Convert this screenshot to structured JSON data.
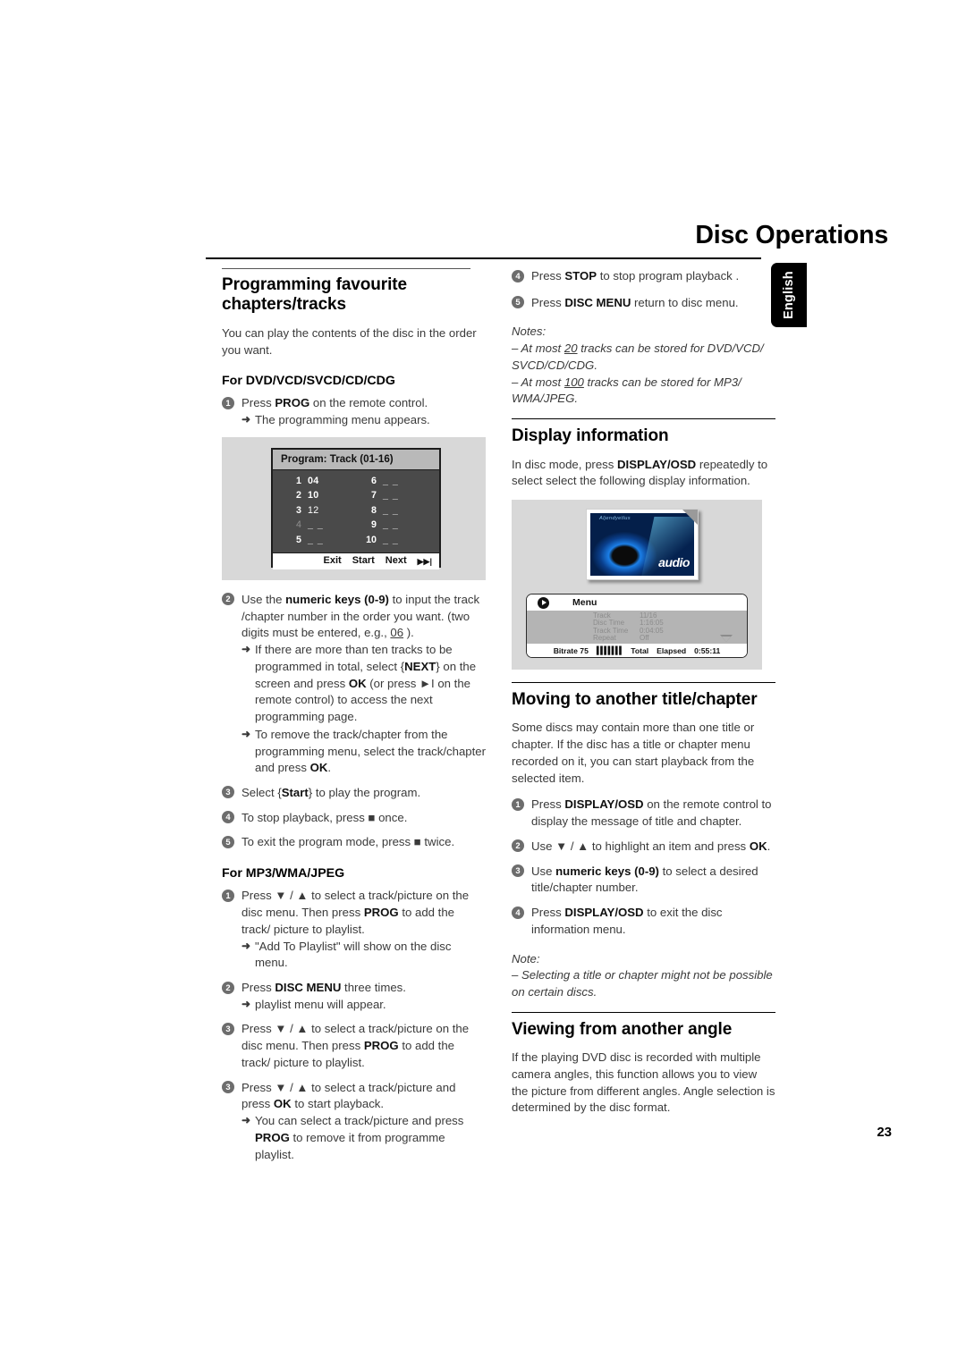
{
  "header": {
    "chapter_title": "Disc Operations",
    "language_tab": "English"
  },
  "page_number": "23",
  "left_column": {
    "section_title": "Programming favourite chapters/tracks",
    "intro": "You can play the contents of the disc in the order you want.",
    "subhead_dvd": "For DVD/VCD/SVCD/CD/CDG",
    "step1": {
      "num": "1",
      "text_pre": "Press ",
      "bold": "PROG",
      "text_post": " on the remote control."
    },
    "step1_arrow": "The programming menu appears.",
    "program_menu": {
      "title": "Program: Track (01-16)",
      "entries_left": [
        {
          "index": "1",
          "value": "04",
          "filled": true,
          "dim": false
        },
        {
          "index": "2",
          "value": "10",
          "filled": true,
          "dim": false
        },
        {
          "index": "3",
          "value": "12",
          "filled": true,
          "dim": false
        },
        {
          "index": "4",
          "value": "_ _",
          "filled": false,
          "dim": true
        },
        {
          "index": "5",
          "value": "_ _",
          "filled": false,
          "dim": false
        }
      ],
      "entries_right": [
        {
          "index": "6",
          "value": "_ _",
          "filled": false,
          "dim": false
        },
        {
          "index": "7",
          "value": "_ _",
          "filled": false,
          "dim": false
        },
        {
          "index": "8",
          "value": "_ _",
          "filled": false,
          "dim": false
        },
        {
          "index": "9",
          "value": "_ _",
          "filled": false,
          "dim": false
        },
        {
          "index": "10",
          "value": "_ _",
          "filled": false,
          "dim": false
        }
      ],
      "buttons": [
        "Exit",
        "Start",
        "Next"
      ],
      "next_icon": "skip-forward-icon"
    },
    "step2": {
      "num": "2",
      "p1_a": "Use the ",
      "p1_b": "numeric keys (0-9)",
      "p1_c": " to input the track /chapter number in the order you want. (two digits must be entered, e.g., ",
      "p1_u": "06",
      "p1_d": " )."
    },
    "step2_arrow1_a": "If there are more than ten tracks to be programmed in total, select {",
    "step2_arrow1_b": "NEXT",
    "step2_arrow1_c": "} on the screen and press ",
    "step2_arrow1_d": "OK",
    "step2_arrow1_e": " (or press ►I on the remote control) to access the next programming page.",
    "step2_arrow2_a": "To remove the track/chapter from the programming menu, select the track/chapter and press ",
    "step2_arrow2_b": "OK",
    "step2_arrow2_c": ".",
    "step3": {
      "num": "3",
      "a": "Select {",
      "b": "Start",
      "c": "} to play the program."
    },
    "step4": {
      "num": "4",
      "a": "To stop playback, press ■ once."
    },
    "step5": {
      "num": "5",
      "a": "To exit the program mode, press ■ twice."
    },
    "subhead_mp3": "For MP3/WMA/JPEG",
    "mp3_step1": {
      "num": "1",
      "a": "Press ▼ / ▲ to select a track/picture on the disc menu. Then press ",
      "b": "PROG",
      "c": " to add the track/ picture to playlist."
    },
    "mp3_step1_arrow": "\"Add To Playlist\" will show on the disc menu.",
    "mp3_step2": {
      "num": "2",
      "a": "Press ",
      "b": "DISC MENU",
      "c": " three times."
    },
    "mp3_step2_arrow": "playlist menu will appear.",
    "mp3_step3": {
      "num": "3",
      "a": "Press ▼ / ▲ to select a track/picture on the disc menu. Then press ",
      "b": "PROG",
      "c": " to add the track/ picture to playlist."
    },
    "mp3_step4": {
      "num": "3",
      "a": "Press ▼ / ▲ to select a track/picture and press ",
      "b": "OK",
      "c": " to start playback."
    },
    "mp3_step4_arrow_a": "You can select a track/picture and press ",
    "mp3_step4_arrow_b": "PROG",
    "mp3_step4_arrow_c": " to remove it from programme playlist."
  },
  "right_column": {
    "step4": {
      "num": "4",
      "a": "Press ",
      "b": "STOP",
      "c": " to stop program playback ."
    },
    "step5": {
      "num": "5",
      "a": "Press ",
      "b": "DISC MENU",
      "c": " return to disc menu."
    },
    "notes_heading": "Notes:",
    "note1_a": "–  At most ",
    "note1_u": "20",
    "note1_b": "  tracks can be stored for DVD/VCD/ SVCD/CD/CDG.",
    "note2_a": "–  At most ",
    "note2_u": "100",
    "note2_b": " tracks can be stored for MP3/ WMA/JPEG.",
    "display_info": {
      "title": "Display information",
      "body_a": "In disc mode, press ",
      "body_b": "DISPLAY/OSD",
      "body_c": " repeatedly to select select the following display information.",
      "osd": {
        "cover_wordmark": "Aljendyetlus",
        "cover_label": "audio",
        "menu_label": "Menu",
        "rows": [
          {
            "key": "Track",
            "value": "11/16"
          },
          {
            "key": "Disc Time",
            "value": "1:16:05"
          },
          {
            "key": "Track Time",
            "value": "0:04:05"
          },
          {
            "key": "Repeat",
            "value": "Off"
          }
        ],
        "footer": {
          "bitrate_label": "Bitrate 75",
          "bars": "▌▌▌▌▌▌▌",
          "total": "Total",
          "elapsed": "Elapsed",
          "time": "0:55:11"
        }
      }
    },
    "moving": {
      "title": "Moving to another title/chapter",
      "body": "Some discs may contain more than one title or chapter. If the disc has a title or chapter menu recorded on it, you can start playback from the selected item.",
      "step1": {
        "num": "1",
        "a": "Press ",
        "b": "DISPLAY/OSD",
        "c": " on the remote control to display the message of title and chapter."
      },
      "step2": {
        "num": "2",
        "a": "Use ▼ / ▲ to highlight an item and press ",
        "b": "OK",
        "c": "."
      },
      "step3": {
        "num": "3",
        "a": "Use ",
        "b": "numeric keys (0-9)",
        "c": " to select a desired title/chapter number."
      },
      "step4": {
        "num": "4",
        "a": "Press ",
        "b": "DISPLAY/OSD",
        "c": " to exit the disc information menu."
      },
      "note_heading": "Note:",
      "note_text": "–  Selecting a title or chapter might not be possible on certain discs."
    },
    "angle": {
      "title": "Viewing from another angle",
      "body": "If the playing DVD disc is recorded with multiple camera angles, this function allows you to view the picture from different angles. Angle selection is determined by the disc format."
    }
  },
  "colors": {
    "figure_bg": "#d8d8d8",
    "osd_dark": "#4a4a4a",
    "osd_title_bar": "#b9b9b9",
    "osd_body_gray": "#b4b4b4",
    "step_bullet": "#6d6d6d",
    "text": "#3a3a3a"
  }
}
